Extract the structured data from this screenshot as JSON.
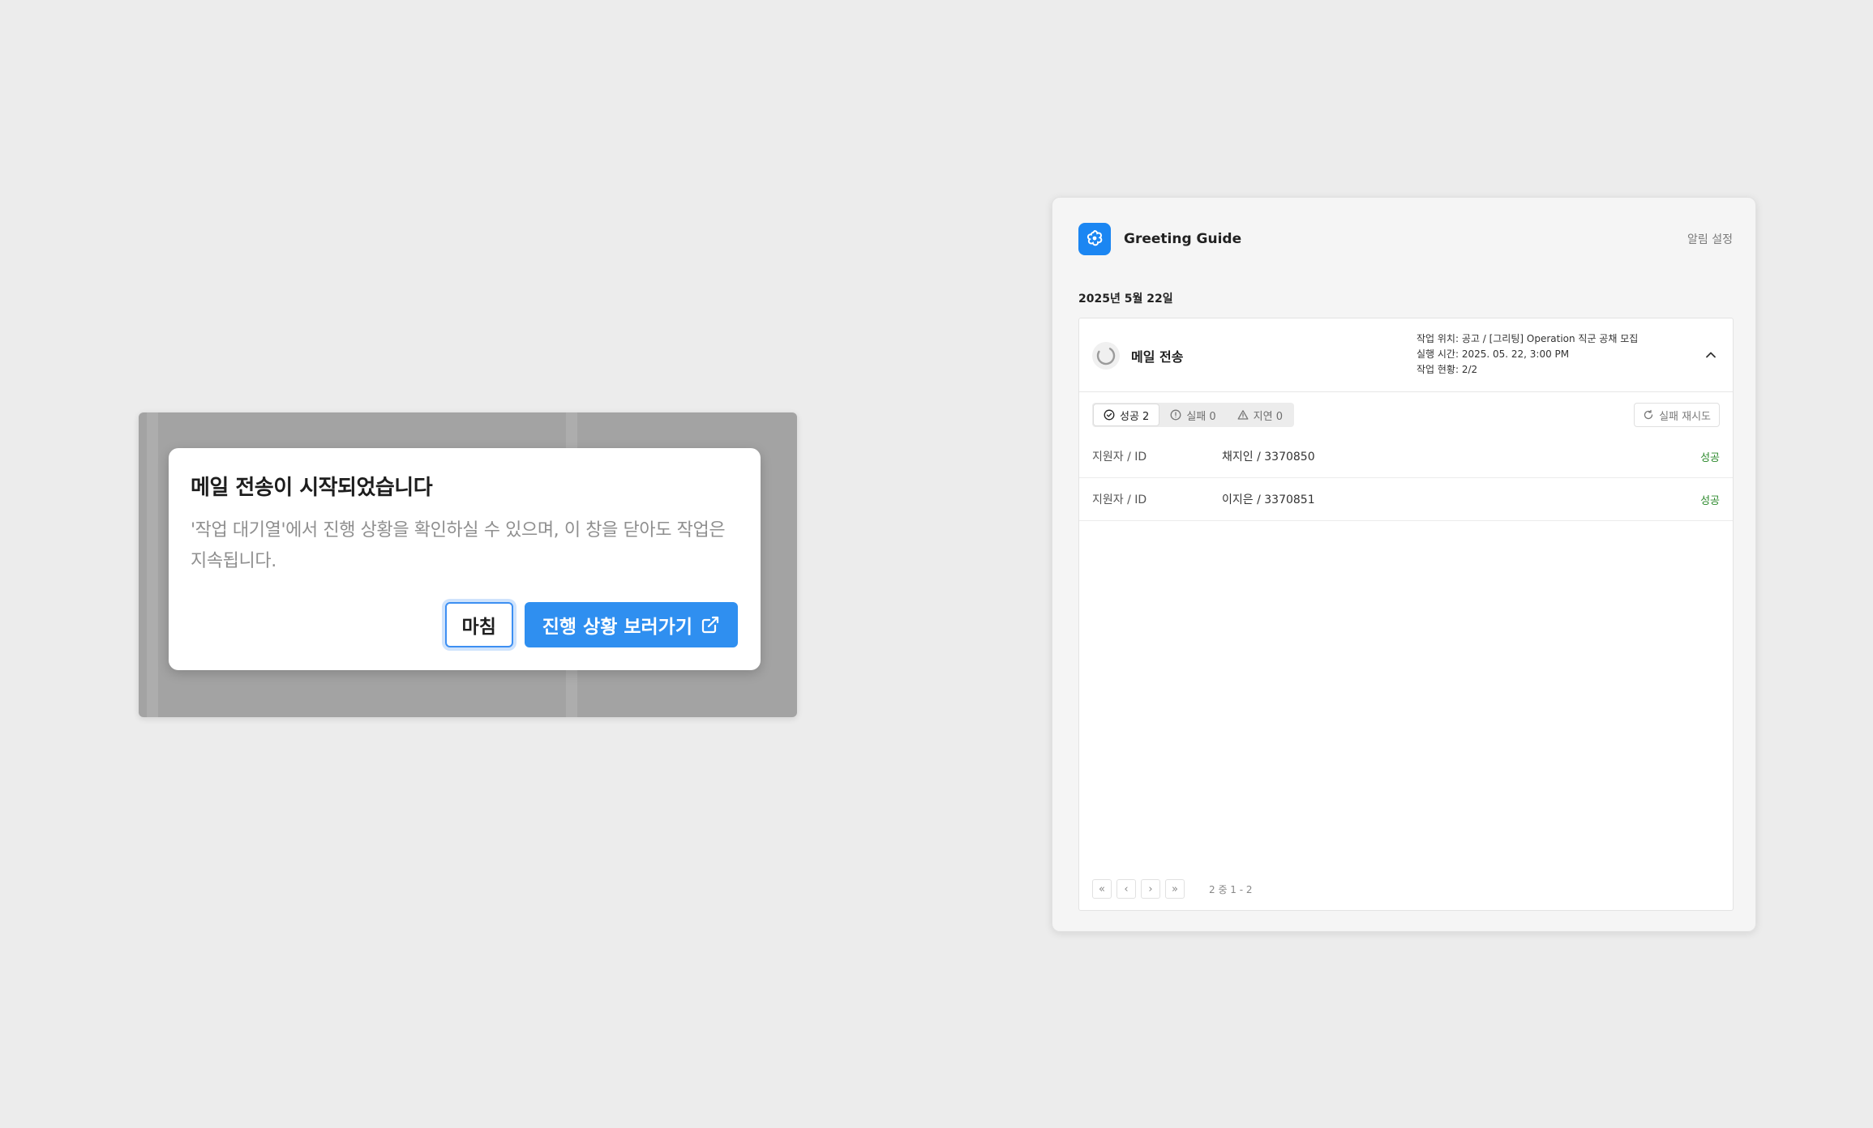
{
  "dialog": {
    "title": "메일 전송이 시작되었습니다",
    "description": "'작업 대기열'에서 진행 상황을 확인하실 수 있으며, 이 창을 닫아도 작업은 지속됩니다.",
    "close_label": "마침",
    "primary_label": "진행 상황 보러가기",
    "primary_icon": "external-link-icon",
    "accent_color": "#2f8ff0"
  },
  "panel": {
    "app_title": "Greeting Guide",
    "app_icon": "greeting-logo-icon",
    "settings_label": "알림 설정",
    "date": "2025년 5월 22일",
    "job": {
      "name": "메일 전송",
      "location": "작업 위치: 공고 / [그리팅] Operation 직군 공채 모집",
      "run_time": "실행 시간: 2025. 05. 22, 3:00 PM",
      "progress": "작업 현황: 2/2"
    },
    "filters": [
      {
        "label": "성공 2",
        "icon": "check-circle-icon"
      },
      {
        "label": "실패 0",
        "icon": "info-circle-icon"
      },
      {
        "label": "지연 0",
        "icon": "warning-triangle-icon"
      }
    ],
    "retry_label": "실패 재시도",
    "rows": [
      {
        "label": "지원자 / ID",
        "value": "채지인 / 3370850",
        "status": "성공"
      },
      {
        "label": "지원자 / ID",
        "value": "이지은 / 3370851",
        "status": "성공"
      }
    ],
    "pagination": {
      "first": "«",
      "prev": "‹",
      "next": "›",
      "last": "»",
      "info": "2 중 1 - 2"
    },
    "success_color": "#2d8a2d"
  }
}
